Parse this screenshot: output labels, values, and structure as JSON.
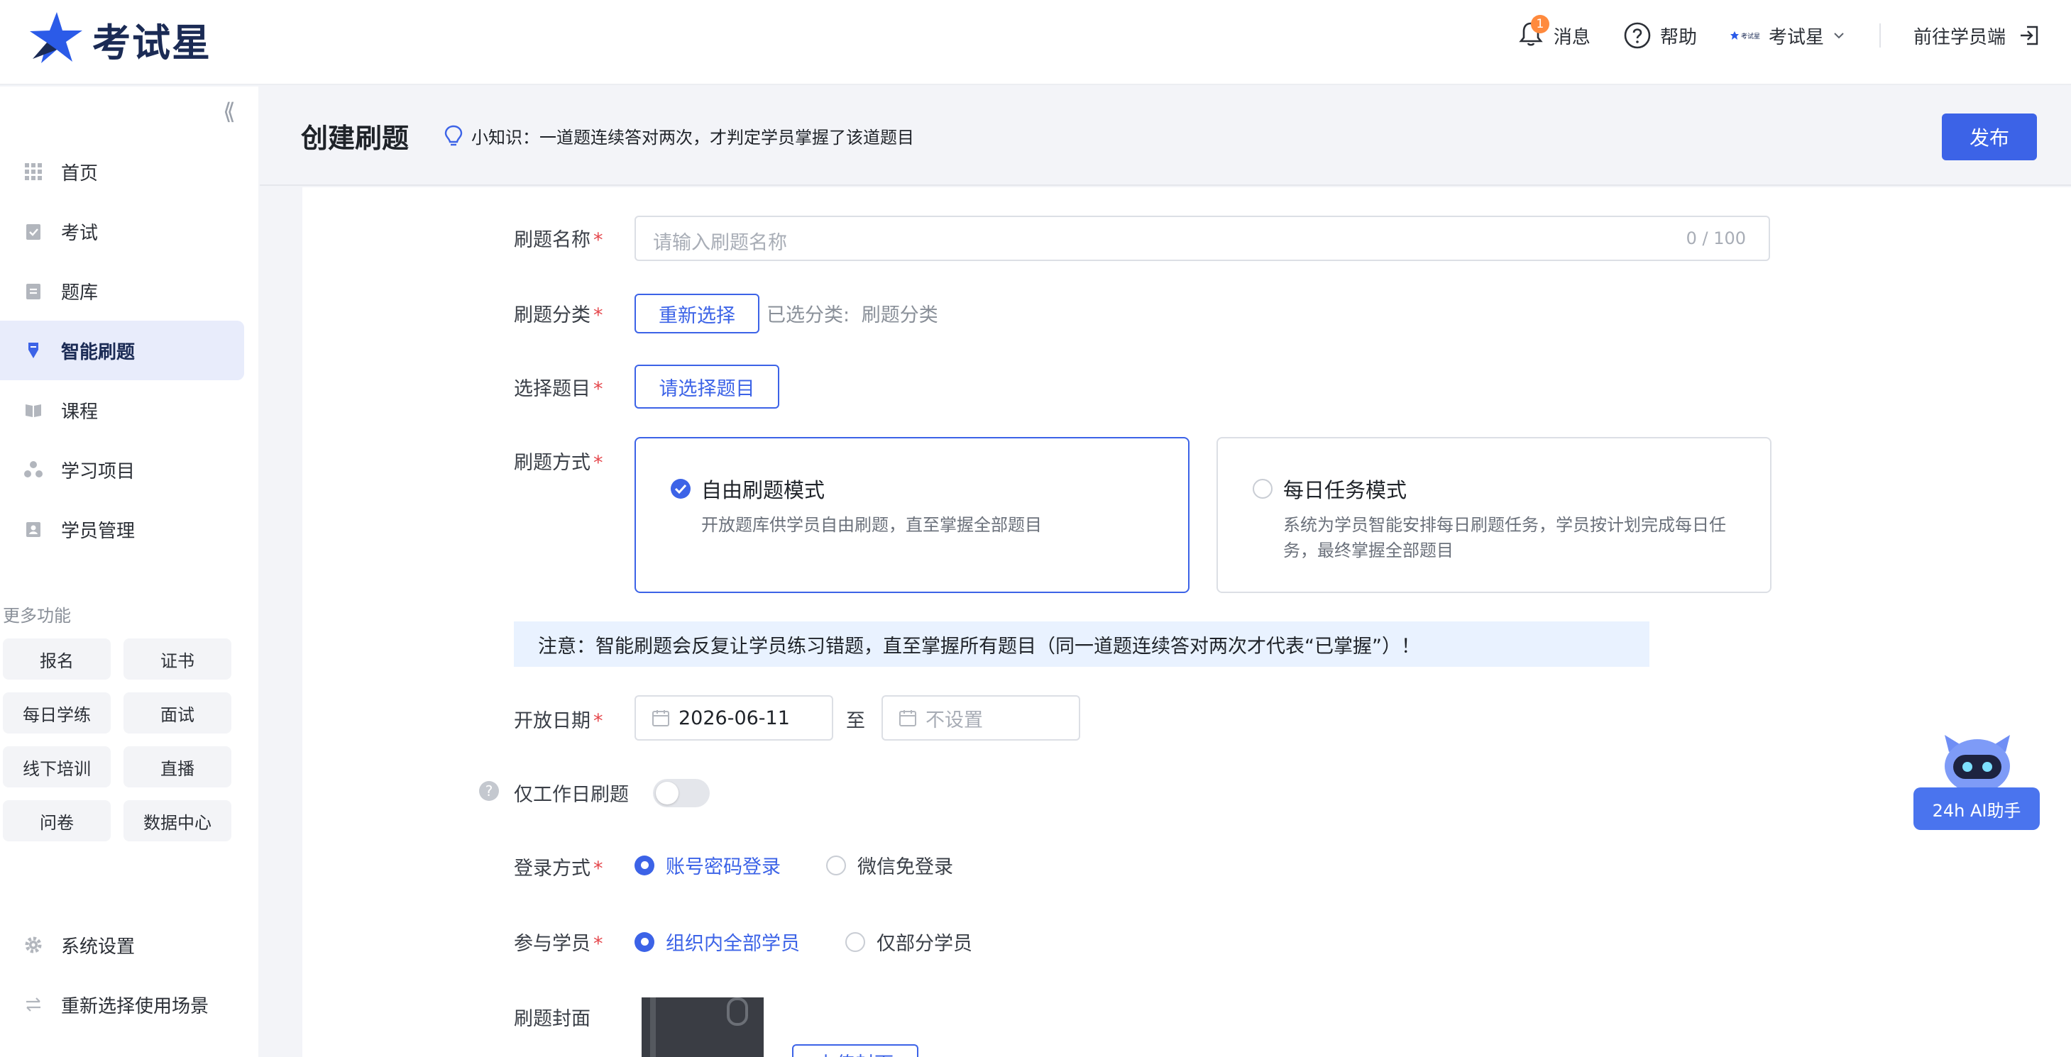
{
  "brand": {
    "name": "考试星"
  },
  "topbar": {
    "notifications": {
      "label": "消息",
      "count": "1"
    },
    "help": {
      "label": "帮助"
    },
    "account": {
      "label": "考试星",
      "mini_logo_text": "考试星"
    },
    "student_portal": {
      "label": "前往学员端"
    }
  },
  "sidebar": {
    "items": [
      {
        "label": "首页",
        "icon": "grid-icon"
      },
      {
        "label": "考试",
        "icon": "clipboard-check-icon"
      },
      {
        "label": "题库",
        "icon": "clipboard-list-icon"
      },
      {
        "label": "智能刷题",
        "icon": "pen-icon",
        "active": true
      },
      {
        "label": "课程",
        "icon": "book-icon"
      },
      {
        "label": "学习项目",
        "icon": "project-icon"
      },
      {
        "label": "学员管理",
        "icon": "user-card-icon"
      }
    ],
    "more_title": "更多功能",
    "more": [
      "报名",
      "证书",
      "每日学练",
      "面试",
      "线下培训",
      "直播",
      "问卷",
      "数据中心"
    ],
    "bottom": [
      {
        "label": "系统设置",
        "icon": "gear-icon"
      },
      {
        "label": "重新选择使用场景",
        "icon": "swap-icon"
      }
    ]
  },
  "header": {
    "title": "创建刷题",
    "tip": "小知识：一道题连续答对两次，才判定学员掌握了该道题目",
    "publish": "发布"
  },
  "form": {
    "name": {
      "label": "刷题名称",
      "placeholder": "请输入刷题名称",
      "counter": "0 / 100"
    },
    "category": {
      "label": "刷题分类",
      "button": "重新选择",
      "selected_prefix": "已选分类:",
      "selected_value": "刷题分类"
    },
    "questions": {
      "label": "选择题目",
      "button": "请选择题目"
    },
    "mode": {
      "label": "刷题方式",
      "options": [
        {
          "title": "自由刷题模式",
          "desc": "开放题库供学员自由刷题，直至掌握全部题目",
          "selected": true
        },
        {
          "title": "每日任务模式",
          "desc": "系统为学员智能安排每日刷题任务，学员按计划完成每日任务，最终掌握全部题目",
          "selected": false
        }
      ]
    },
    "notice": "注意：智能刷题会反复让学员练习错题，直至掌握所有题目（同一道题连续答对两次才代表“已掌握”）！",
    "open_date": {
      "label": "开放日期",
      "start": "2026-06-11",
      "separator": "至",
      "end_placeholder": "不设置"
    },
    "workday": {
      "label": "仅工作日刷题",
      "enabled": false
    },
    "login": {
      "label": "登录方式",
      "options": [
        "账号密码登录",
        "微信免登录"
      ],
      "selected": 0
    },
    "participants": {
      "label": "参与学员",
      "options": [
        "组织内全部学员",
        "仅部分学员"
      ],
      "selected": 0
    },
    "cover": {
      "label": "刷题封面",
      "button": "上传封面"
    }
  },
  "ai_helper": {
    "label": "24h AI助手"
  },
  "colors": {
    "primary": "#3c63e7",
    "notice_bg": "#e9f2ff",
    "required": "#e5484d"
  }
}
